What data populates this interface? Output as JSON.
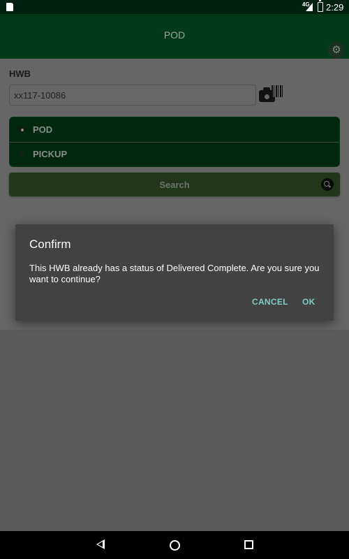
{
  "status_bar": {
    "network": "4G",
    "time": "2:29",
    "icons": [
      "sd-card-icon",
      "signal-icon",
      "battery-charging-icon"
    ]
  },
  "app_bar": {
    "title": "POD",
    "settings_icon": "gear-icon"
  },
  "form": {
    "hwb_label": "HWB",
    "hwb_value": "xx117-10086",
    "scan_icon": "camera-barcode-icon",
    "radio_options": [
      {
        "label": "POD",
        "selected": true
      },
      {
        "label": "PICKUP",
        "selected": false
      }
    ],
    "search_label": "Search",
    "search_icon": "search-icon"
  },
  "dialog": {
    "title": "Confirm",
    "message": "This HWB already has a status of Delivered Complete.  Are you sure you want to continue?",
    "cancel_label": "CANCEL",
    "ok_label": "OK",
    "button_color": "#80cbc4"
  },
  "nav_bar": {
    "icons": [
      "back-icon",
      "home-icon",
      "recents-icon"
    ]
  },
  "colors": {
    "primary_dark": "#003a19",
    "dialog_bg": "#424242",
    "accent": "#80cbc4"
  }
}
